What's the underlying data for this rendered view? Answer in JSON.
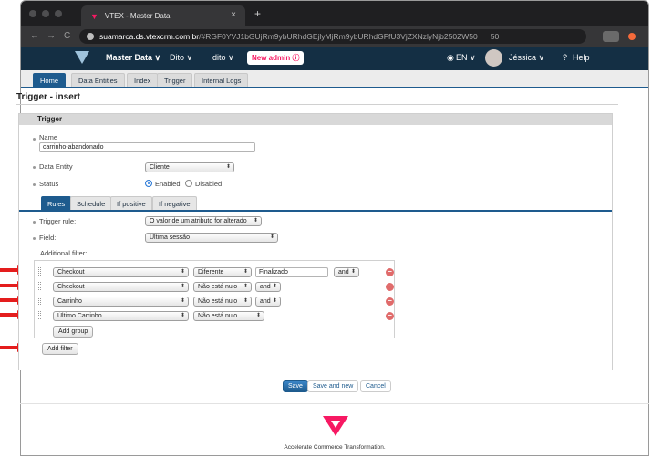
{
  "browser": {
    "tab_title": "VTEX - Master Data",
    "tab_close": "×",
    "new_tab": "+",
    "url_host": "suamarca.ds.vtexcrm.com.br",
    "url_path": "/#RGF0YVJ1bGUjRm9ybURhdGEjlyMjRm9ybURhdGFfU3VjZXNzlyNjb250ZW50",
    "url_extra": "50",
    "back": "←",
    "forward": "→",
    "reload": "C"
  },
  "header": {
    "app_menu": "Master Data ∨",
    "store_menu": "Dito ∨",
    "entity_menu": "dito ∨",
    "new_admin_badge": "New admin ⓘ",
    "language": "EN ∨",
    "user": "Jéssica ∨",
    "help": "Help"
  },
  "subnav": [
    "Home",
    "Data Entities",
    "Index",
    "Trigger",
    "Internal Logs"
  ],
  "page": {
    "title": "Trigger - insert",
    "panel_title": "Trigger"
  },
  "form": {
    "name_label": "Name",
    "name_value": "carrinho-abandonado",
    "data_entity_label": "Data Entity",
    "data_entity_value": "Cliente",
    "status_label": "Status",
    "status_enabled": "Enabled",
    "status_disabled": "Disabled"
  },
  "rule_tabs": [
    "Rules",
    "Schedule",
    "If positive",
    "If negative"
  ],
  "rules": {
    "trigger_rule_label": "Trigger rule:",
    "trigger_rule_value": "O valor de um atributo for alterado",
    "field_label": "Field:",
    "field_value": "Última sessão",
    "additional_filter_label": "Additional filter:",
    "filters": [
      {
        "field": "Checkout",
        "op": "Diferente",
        "value": "Finalizado",
        "conj": "and"
      },
      {
        "field": "Checkout",
        "op": "Não está nulo",
        "conj": "and"
      },
      {
        "field": "Carrinho",
        "op": "Não está nulo",
        "conj": "and"
      },
      {
        "field": "Último Carrinho",
        "op": "Não está nulo"
      }
    ],
    "add_group": "Add group",
    "add_filter": "Add filter"
  },
  "actions": {
    "save": "Save",
    "save_and_new": "Save and new",
    "cancel": "Cancel"
  },
  "footer": {
    "tagline": "Accelerate Commerce Transformation."
  },
  "colors": {
    "header_bg": "#142f44",
    "accent": "#1e5b8e",
    "brand": "#f71963",
    "annotation_arrow": "#e41d1d"
  }
}
